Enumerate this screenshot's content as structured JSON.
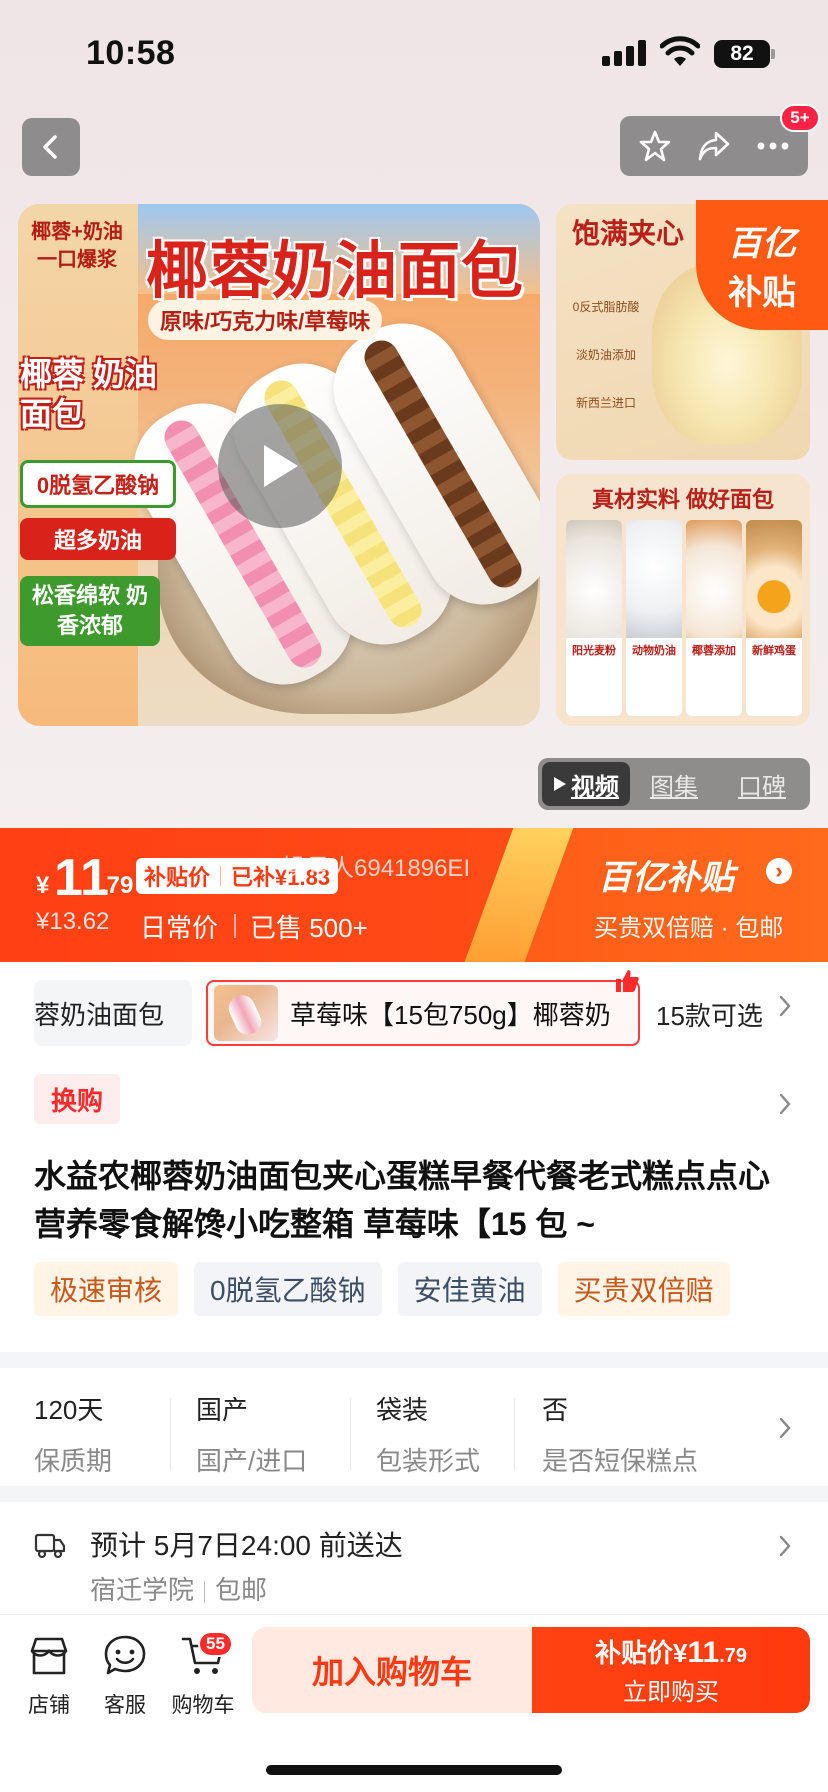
{
  "status_bar": {
    "time": "10:58",
    "battery": "82"
  },
  "nav": {
    "back_icon": "chevron-left-icon",
    "badge": "5+"
  },
  "gallery": {
    "main": {
      "title": "椰蓉奶油面包",
      "flavors": "原味/巧克力味/草莓味",
      "side_top": "椰蓉+奶油 一口爆浆",
      "side_name": "椰蓉 奶油面包",
      "pill_a": "0脱氢乙酸钠",
      "pill_b": "超多奶油",
      "pill_c": "松香绵软 奶香浓郁"
    },
    "thumb1": {
      "title": "饱满夹心",
      "notes": [
        "0反式脂肪酸",
        "淡奶油添加",
        "新西兰进口"
      ]
    },
    "thumb2": {
      "title": "真材实料 做好面包",
      "ingredients": [
        {
          "name": "阳光麦粉"
        },
        {
          "name": "动物奶油"
        },
        {
          "name": "椰蓉添加"
        },
        {
          "name": "新鲜鸡蛋"
        }
      ]
    },
    "subsidy_corner": {
      "line1": "百亿",
      "line2": "补贴"
    },
    "media_tabs": [
      "视频",
      "图集",
      "口碑"
    ]
  },
  "price": {
    "currency": "¥",
    "int": "11",
    "dec": ".79",
    "tag_label": "补贴价",
    "tag_saving": "已补¥1.83",
    "watermark": "操号人6941896EI",
    "original": "¥13.62",
    "original_label": "日常价",
    "sold": "已售 500+",
    "brand": "百亿补贴",
    "note": "买贵双倍赔 · 包邮"
  },
  "sku": {
    "prev": "椰蓉奶油面包",
    "selected": "草莓味【15包750g】椰蓉奶",
    "more": "15款可选"
  },
  "product": {
    "swap_badge": "换购",
    "title": "水益农椰蓉奶油面包夹心蛋糕早餐代餐老式糕点点心营养零食解馋小吃整箱 草莓味【15 包 ~",
    "tags": [
      "极速审核",
      "0脱氢乙酸钠",
      "安佳黄油",
      "买贵双倍赔"
    ]
  },
  "attributes": [
    {
      "value": "120天",
      "key": "保质期"
    },
    {
      "value": "国产",
      "key": "国产/进口"
    },
    {
      "value": "袋装",
      "key": "包装形式"
    },
    {
      "value": "否",
      "key": "是否短保糕点"
    }
  ],
  "delivery": {
    "eta": "预计 5月7日24:00 前送达",
    "location": "宿迁学院",
    "shipping": "包邮"
  },
  "bottom_bar": {
    "shop": "店铺",
    "service": "客服",
    "cart": "购物车",
    "cart_count": "55",
    "add_cart": "加入购物车",
    "buy_label": "补贴价¥",
    "buy_int": "11",
    "buy_dec": ".79",
    "buy_now": "立即购买"
  },
  "colors": {
    "accent": "#ff4a16",
    "subsidy": "#ff5a14",
    "title_red": "#d8221a"
  }
}
